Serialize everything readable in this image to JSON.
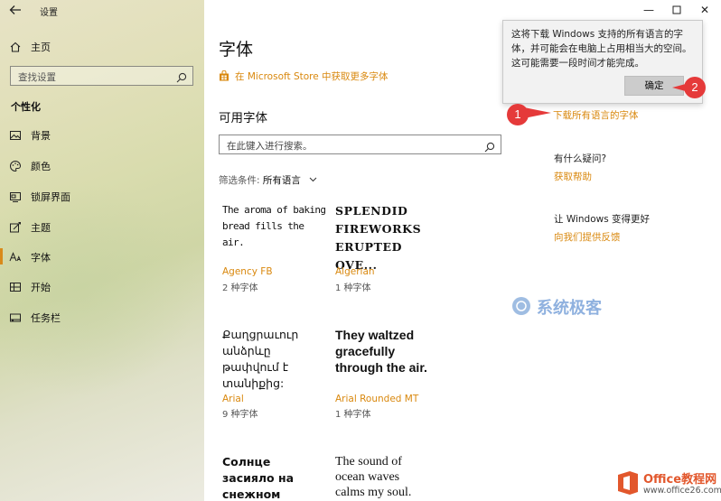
{
  "window": {
    "title": "设置",
    "min": "—",
    "max": "☐",
    "close": "✕"
  },
  "sidebar": {
    "home_label": "主页",
    "search_placeholder": "查找设置",
    "section_title": "个性化",
    "items": [
      {
        "label": "背景",
        "icon": "picture-icon"
      },
      {
        "label": "颜色",
        "icon": "palette-icon"
      },
      {
        "label": "锁屏界面",
        "icon": "lock-screen-icon"
      },
      {
        "label": "主题",
        "icon": "theme-icon"
      },
      {
        "label": "字体",
        "icon": "font-icon",
        "active": true
      },
      {
        "label": "开始",
        "icon": "start-icon"
      },
      {
        "label": "任务栏",
        "icon": "taskbar-icon"
      }
    ]
  },
  "main": {
    "title": "字体",
    "store_link": "在 Microsoft Store 中获取更多字体",
    "available_title": "可用字体",
    "search_placeholder": "在此键入进行搜索。",
    "filter_label": "筛选条件:",
    "filter_value": "所有语言",
    "fonts": [
      {
        "sample": "The aroma of baking bread fills the air.",
        "name": "Agency FB",
        "count": "2 种字体"
      },
      {
        "sample": "SPLENDID FIREWORKS ERUPTED OVE...",
        "name": "Algerian",
        "count": "1 种字体"
      },
      {
        "sample": "Քաղցրաւուր անձրևը թափվում է տանիքից:",
        "name": "Arial",
        "count": "9 种字体"
      },
      {
        "sample": "They waltzed gracefully through the air.",
        "name": "Arial Rounded MT",
        "count": "1 种字体"
      },
      {
        "sample": "Солнце засияло на снежном ковре.",
        "name": "",
        "count": ""
      },
      {
        "sample": "The sound of ocean waves calms my soul.",
        "name": "",
        "count": ""
      }
    ]
  },
  "right": {
    "download_link": "下载所有语言的字体",
    "help_question": "有什么疑问?",
    "help_link": "获取帮助",
    "improve_question": "让 Windows 变得更好",
    "feedback_link": "向我们提供反馈"
  },
  "popup": {
    "message": "这将下载 Windows 支持的所有语言的字体，并可能会在电脑上占用相当大的空间。这可能需要一段时间才能完成。",
    "ok_label": "确定"
  },
  "badges": {
    "one": "1",
    "two": "2"
  },
  "watermarks": {
    "center": "系统极客",
    "corner_brand": "Office教程网",
    "corner_url": "www.office26.com"
  },
  "colors": {
    "accent": "#d9880e",
    "badge": "#e53a3a",
    "active_bar": "#d98a1a"
  }
}
